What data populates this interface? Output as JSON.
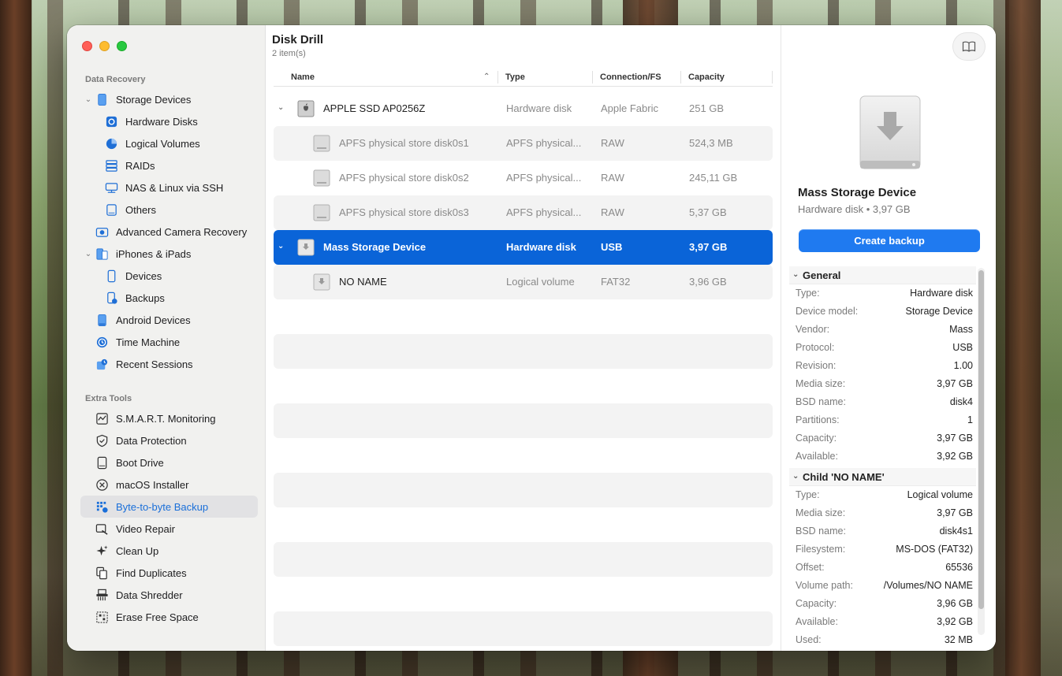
{
  "app": {
    "title": "Disk Drill",
    "item_count": "2 item(s)"
  },
  "sidebar": {
    "sections": {
      "data_recovery": "Data Recovery",
      "extra_tools": "Extra Tools"
    },
    "items": [
      {
        "label": "Storage Devices",
        "icon": "storage-icon"
      },
      {
        "label": "Hardware Disks",
        "icon": "hardware-disk-icon"
      },
      {
        "label": "Logical Volumes",
        "icon": "pie-chart-icon"
      },
      {
        "label": "RAIDs",
        "icon": "raid-icon"
      },
      {
        "label": "NAS & Linux via SSH",
        "icon": "nas-icon"
      },
      {
        "label": "Others",
        "icon": "others-icon"
      },
      {
        "label": "Advanced Camera Recovery",
        "icon": "camera-icon"
      },
      {
        "label": "iPhones & iPads",
        "icon": "iphone-icon"
      },
      {
        "label": "Devices",
        "icon": "device-icon"
      },
      {
        "label": "Backups",
        "icon": "backup-icon"
      },
      {
        "label": "Android Devices",
        "icon": "android-icon"
      },
      {
        "label": "Time Machine",
        "icon": "time-machine-icon"
      },
      {
        "label": "Recent Sessions",
        "icon": "recent-sessions-icon"
      }
    ],
    "tools": [
      {
        "label": "S.M.A.R.T. Monitoring",
        "icon": "smart-icon"
      },
      {
        "label": "Data Protection",
        "icon": "shield-icon"
      },
      {
        "label": "Boot Drive",
        "icon": "boot-drive-icon"
      },
      {
        "label": "macOS Installer",
        "icon": "macos-installer-icon"
      },
      {
        "label": "Byte-to-byte Backup",
        "icon": "byte-backup-icon"
      },
      {
        "label": "Video Repair",
        "icon": "video-repair-icon"
      },
      {
        "label": "Clean Up",
        "icon": "sparkle-icon"
      },
      {
        "label": "Find Duplicates",
        "icon": "duplicates-icon"
      },
      {
        "label": "Data Shredder",
        "icon": "shredder-icon"
      },
      {
        "label": "Erase Free Space",
        "icon": "erase-icon"
      }
    ]
  },
  "table": {
    "columns": {
      "name": "Name",
      "type": "Type",
      "conn": "Connection/FS",
      "capacity": "Capacity"
    },
    "rows": [
      {
        "name": "APPLE SSD AP0256Z",
        "type": "Hardware disk",
        "conn": "Apple Fabric",
        "capacity": "251 GB"
      },
      {
        "name": "APFS physical store disk0s1",
        "type": "APFS physical...",
        "conn": "RAW",
        "capacity": "524,3 MB"
      },
      {
        "name": "APFS physical store disk0s2",
        "type": "APFS physical...",
        "conn": "RAW",
        "capacity": "245,11 GB"
      },
      {
        "name": "APFS physical store disk0s3",
        "type": "APFS physical...",
        "conn": "RAW",
        "capacity": "5,37 GB"
      },
      {
        "name": "Mass Storage Device",
        "type": "Hardware disk",
        "conn": "USB",
        "capacity": "3,97 GB"
      },
      {
        "name": "NO NAME",
        "type": "Logical volume",
        "conn": "FAT32",
        "capacity": "3,96 GB"
      }
    ]
  },
  "details": {
    "name": "Mass Storage Device",
    "subtitle": "Hardware disk • 3,97 GB",
    "backup_button": "Create backup",
    "general_title": "General",
    "general": [
      {
        "k": "Type:",
        "v": "Hardware disk"
      },
      {
        "k": "Device model:",
        "v": "Storage Device"
      },
      {
        "k": "Vendor:",
        "v": "Mass"
      },
      {
        "k": "Protocol:",
        "v": "USB"
      },
      {
        "k": "Revision:",
        "v": "1.00"
      },
      {
        "k": "Media size:",
        "v": "3,97 GB"
      },
      {
        "k": "BSD name:",
        "v": "disk4"
      },
      {
        "k": "Partitions:",
        "v": "1"
      },
      {
        "k": "Capacity:",
        "v": "3,97 GB"
      },
      {
        "k": "Available:",
        "v": "3,92 GB"
      }
    ],
    "child_title": "Child 'NO NAME'",
    "child": [
      {
        "k": "Type:",
        "v": "Logical volume"
      },
      {
        "k": "Media size:",
        "v": "3,97 GB"
      },
      {
        "k": "BSD name:",
        "v": "disk4s1"
      },
      {
        "k": "Filesystem:",
        "v": "MS-DOS (FAT32)"
      },
      {
        "k": "Offset:",
        "v": "65536"
      },
      {
        "k": "Volume path:",
        "v": "/Volumes/NO NAME"
      },
      {
        "k": "Capacity:",
        "v": "3,96 GB"
      },
      {
        "k": "Available:",
        "v": "3,92 GB"
      },
      {
        "k": "Used:",
        "v": "32 MB"
      }
    ]
  },
  "colors": {
    "accent": "#0a64d8",
    "button": "#1f7af0",
    "active_text": "#1a6fd9"
  }
}
